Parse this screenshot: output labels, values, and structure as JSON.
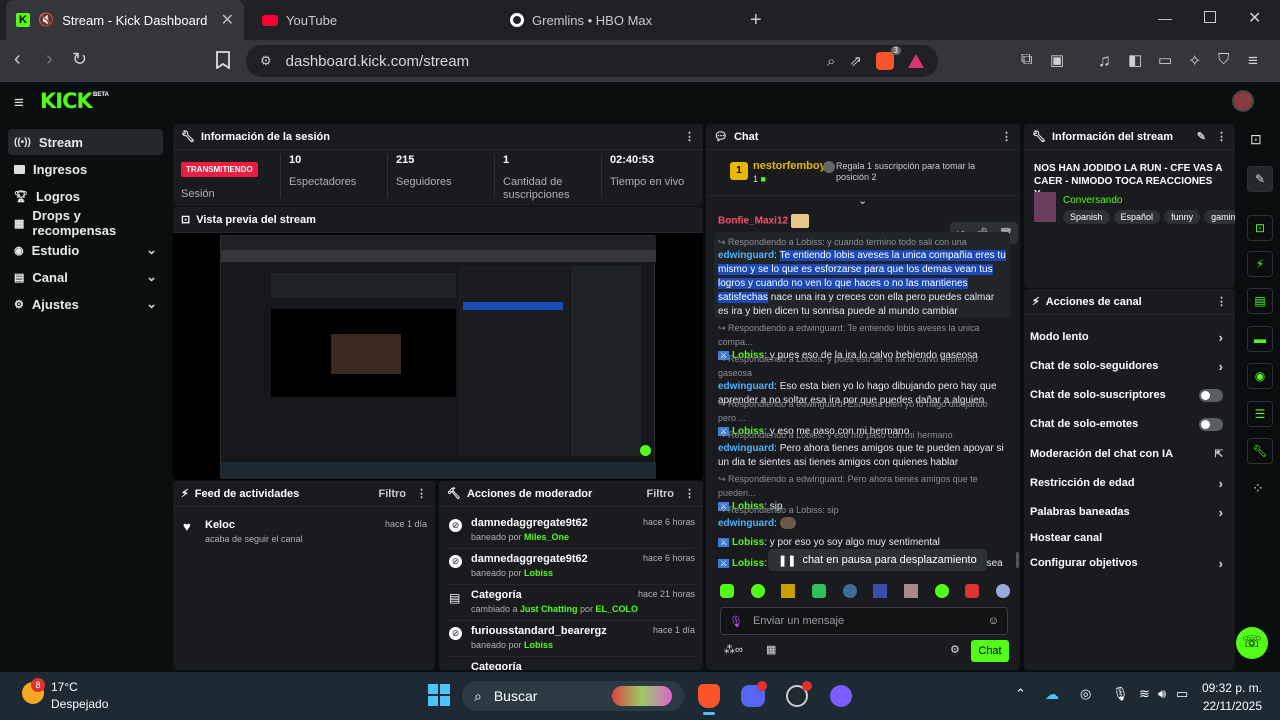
{
  "browser": {
    "tabs": [
      {
        "title": "Stream - Kick Dashboard",
        "active": true
      },
      {
        "title": "YouTube",
        "active": false
      },
      {
        "title": "Gremlins • HBO Max",
        "active": false
      }
    ],
    "url": "dashboard.kick.com/stream",
    "brave_badge": "3"
  },
  "kick": {
    "logo": "KICK",
    "beta": "BETA",
    "nav": [
      {
        "label": "Stream",
        "selected": true,
        "expandable": false
      },
      {
        "label": "Ingresos",
        "selected": false,
        "expandable": false
      },
      {
        "label": "Logros",
        "selected": false,
        "expandable": false
      },
      {
        "label": "Drops y recompensas",
        "selected": false,
        "expandable": false
      },
      {
        "label": "Estudio",
        "selected": false,
        "expandable": true
      },
      {
        "label": "Canal",
        "selected": false,
        "expandable": true
      },
      {
        "label": "Ajustes",
        "selected": false,
        "expandable": true
      }
    ]
  },
  "session": {
    "title": "Información de la sesión",
    "live_badge": "TRANSMITIENDO",
    "session_label": "Sesión",
    "stats": [
      {
        "value": "10",
        "label": "Espectadores"
      },
      {
        "value": "215",
        "label": "Seguidores"
      },
      {
        "value": "1",
        "label": "Cantidad de suscripciones"
      },
      {
        "value": "02:40:53",
        "label": "Tiempo en vivo"
      }
    ]
  },
  "preview": {
    "title": "Vista previa del stream"
  },
  "activity": {
    "title": "Feed de actividades",
    "filter": "Filtro",
    "items": [
      {
        "name": "Keloc",
        "desc": "acaba de seguir el canal",
        "time": "hace 1 día"
      }
    ]
  },
  "modactions": {
    "title": "Acciones de moderador",
    "filter": "Filtro",
    "items": [
      {
        "title": "damnedaggregate9t62",
        "pre": "baneado por ",
        "who": "Miles_One",
        "mid": "",
        "who2": "",
        "time": "hace 6 horas"
      },
      {
        "title": "damnedaggregate9t62",
        "pre": "baneado por ",
        "who": "Lobiss",
        "mid": "",
        "who2": "",
        "time": "hace 6 horas"
      },
      {
        "title": "Categoría",
        "pre": "cambiado a ",
        "who": "Just Chatting",
        "mid": " por ",
        "who2": "EL_COLO",
        "time": "hace 21 horas"
      },
      {
        "title": "furiousstandard_bearergz",
        "pre": "baneado por ",
        "who": "Lobiss",
        "mid": "",
        "who2": "",
        "time": "hace 1 día"
      }
    ],
    "partial": "Categoría"
  },
  "chat": {
    "title": "Chat",
    "gift_user": "nestorfemboy",
    "gift_count": "1",
    "gift_rank": "1",
    "gift_text": "Regala 1 suscripción para tomar la posición 2",
    "top_user": "Bonfie_Maxi12",
    "lines": [
      {
        "reply": "Respondiendo a Lobiss: y cuando termino todo sali con una",
        "user": "edwinguard",
        "text": "Te entiendo lobis aveses la unica compañia eres tu mismo y se lo que es esforzarse para que los demas vean tus logros y cuando no ven lo que haces o no las mantienes satisfechas",
        "text2": " nace una ira y creces con ella pero puedes calmar es ira y bien dicen tu sonrisa puede al mundo cambiar"
      },
      {
        "reply": "Respondiendo a edwinguard: Te entiendo lobis aveses la unica compa...",
        "user": "Lobiss",
        "text": "y pues eso de la ira lo calvo bebiendo gaseosa"
      },
      {
        "reply": "Respondiendo a Lobiss: y pues eso de la ira lo calvo bebiendo gaseosa",
        "user": "edwinguard",
        "text": "Eso esta bien yo lo hago dibujando pero hay que aprender a no soltar esa ira por que puedes dañar a alguien"
      },
      {
        "reply": "Respondiendo a edwinguard: Eso esta bien yo lo hago dibujando pero ...",
        "user": "Lobiss",
        "text": "y eso me paso con mi hermano"
      },
      {
        "reply": "Respondiendo a Lobiss: y eso me paso con mi hermano",
        "user": "edwinguard",
        "text": "Pero ahora tienes amigos que te pueden apoyar si un dia te sientes asi tienes amigos con quienes hablar"
      },
      {
        "reply": "Respondiendo a edwinguard: Pero ahora tienes amigos que te pueden...",
        "user": "Lobiss",
        "text": "sip"
      },
      {
        "reply": "Respondiendo a Lobiss: sip",
        "user": "edwinguard",
        "text": ""
      },
      {
        "reply": "",
        "user": "Lobiss",
        "text": "y por eso yo soy algo muy sentimental"
      },
      {
        "reply": "",
        "user": "Lobiss",
        "text": "unque sea"
      }
    ],
    "paused": "chat en pausa para desplazamiento",
    "input_placeholder": "Enviar un mensaje",
    "send": "Chat"
  },
  "streaminfo": {
    "title": "Información del stream",
    "stream_title": "NOS HAN JODIDO LA RUN - CFE VAS A CAER - NIMODO TOCA REACCIONES Y...",
    "category": "Conversando",
    "tags": [
      "Spanish",
      "Español",
      "funny",
      "gamin"
    ]
  },
  "channel_actions": {
    "title": "Acciones de canal",
    "items": [
      {
        "label": "Modo lento",
        "control": "chevron"
      },
      {
        "label": "Chat de solo-seguidores",
        "control": "chevron"
      },
      {
        "label": "Chat de solo-suscriptores",
        "control": "toggle"
      },
      {
        "label": "Chat de solo-emotes",
        "control": "toggle"
      },
      {
        "label": "Moderación del chat con IA",
        "control": "external"
      },
      {
        "label": "Restricción de edad",
        "control": "chevron"
      },
      {
        "label": "Palabras baneadas",
        "control": "chevron"
      },
      {
        "label": "Hostear canal",
        "control": "none"
      },
      {
        "label": "Configurar objetivos",
        "control": "chevron"
      }
    ]
  },
  "taskbar": {
    "weather_temp": "17°C",
    "weather_desc": "Despejado",
    "weather_badge": "8",
    "search": "Buscar",
    "time": "09:32 p. m.",
    "date": "22/11/2025"
  },
  "colors": {
    "kick_green": "#53fc18",
    "live_red": "#e91e40",
    "highlight_blue": "#1c49b8"
  }
}
